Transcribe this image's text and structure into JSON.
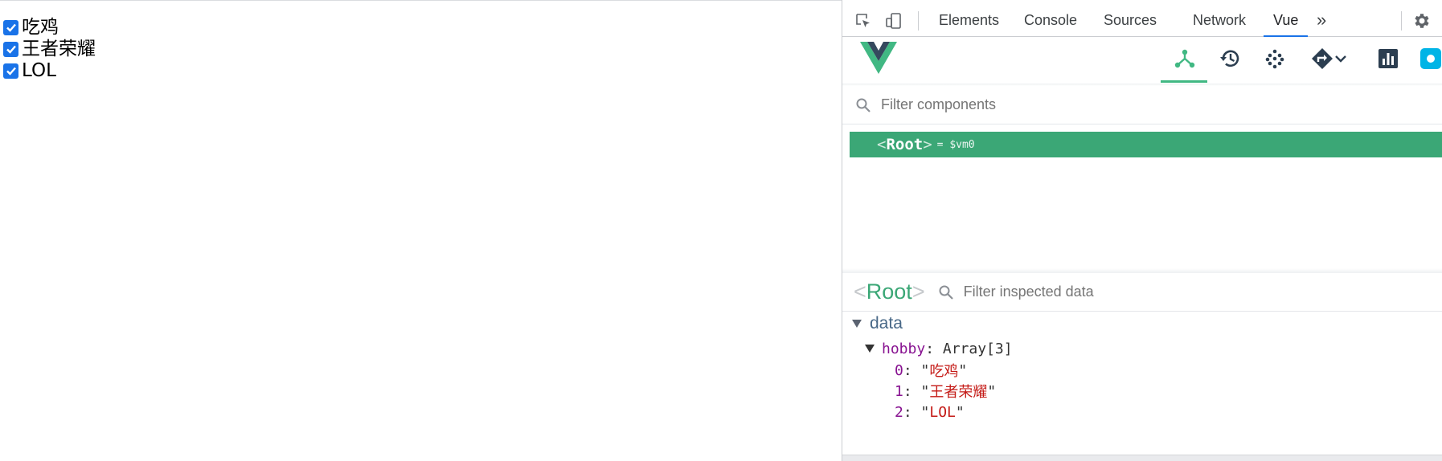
{
  "page": {
    "checkboxes": [
      {
        "label": "吃鸡",
        "checked": true
      },
      {
        "label": "王者荣耀",
        "checked": true
      },
      {
        "label": "LOL",
        "checked": true
      }
    ]
  },
  "devtools": {
    "tabs": [
      "Elements",
      "Console",
      "Sources",
      "Network",
      "Vue"
    ],
    "active_tab": "Vue",
    "more_tabs_glyph": "»",
    "accent_color": "#1a73e8"
  },
  "vue": {
    "brand_colors": {
      "green": "#41b883",
      "dark": "#35495e"
    },
    "filter_components_placeholder": "Filter components",
    "tree_root": {
      "open": "<",
      "name": "Root",
      "close": ">",
      "alias": "= $vm0"
    },
    "inspected": {
      "open": "<",
      "name": "Root",
      "close": ">",
      "filter_placeholder": "Filter inspected data",
      "section": "data",
      "prop_key": "hobby",
      "prop_type": "Array[3]",
      "items": [
        {
          "index": "0",
          "value": "吃鸡"
        },
        {
          "index": "1",
          "value": "王者荣耀"
        },
        {
          "index": "2",
          "value": "LOL"
        }
      ]
    }
  }
}
